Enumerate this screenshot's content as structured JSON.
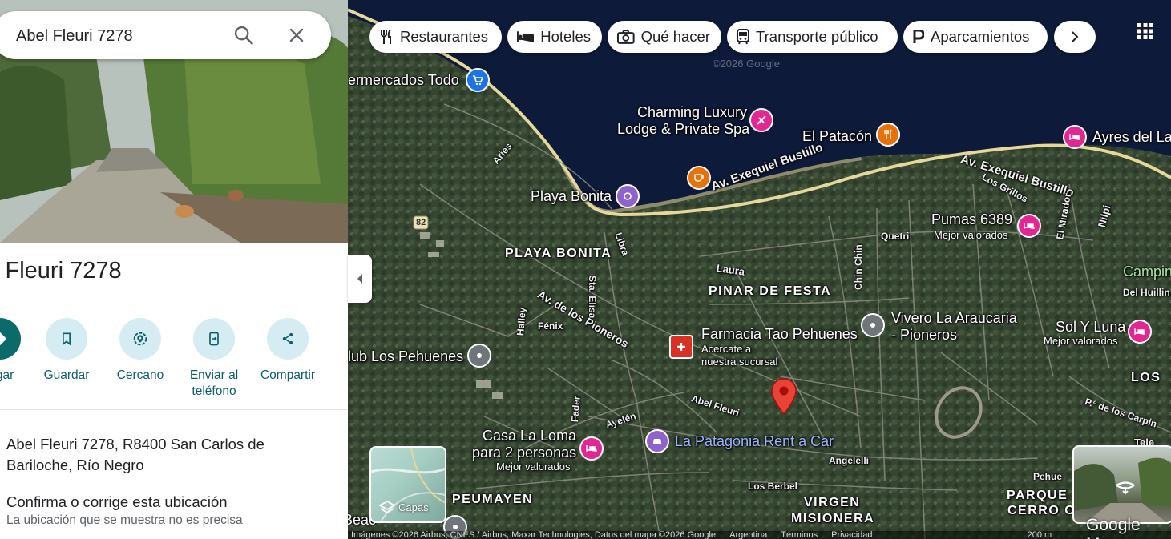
{
  "search": {
    "value": "Abel Fleuri 7278"
  },
  "place": {
    "title": "l Fleuri 7278",
    "actions": [
      {
        "label": "legar",
        "icon": "directions-icon"
      },
      {
        "label": "Guardar",
        "icon": "bookmark-icon"
      },
      {
        "label": "Cercano",
        "icon": "nearby-icon"
      },
      {
        "label": "Enviar al teléfono",
        "icon": "send-to-phone-icon"
      },
      {
        "label": "Compartir",
        "icon": "share-icon"
      }
    ],
    "address": "Abel Fleuri 7278, R8400 San Carlos de Bariloche, Río Negro",
    "confirm_title": "Confirma o corrige esta ubicación",
    "confirm_sub": "La ubicación que se muestra no es precisa"
  },
  "categories": [
    {
      "label": "Restaurantes",
      "icon": "restaurant-icon"
    },
    {
      "label": "Hoteles",
      "icon": "hotel-icon"
    },
    {
      "label": "Qué hacer",
      "icon": "camera-icon"
    },
    {
      "label": "Transporte público",
      "icon": "transit-icon"
    },
    {
      "label": "Aparcamientos",
      "icon": "parking-icon"
    }
  ],
  "map": {
    "pois": {
      "supermercado": "ermercados Todo",
      "charming_line1": "Charming Luxury",
      "charming_line2": "Lodge & Private Spa",
      "patacon": "El Patacón",
      "ayres": "Ayres del Lag",
      "playa_bonita": "Playa Bonita",
      "pumas": "Pumas 6389",
      "pumas_sub": "Mejor valorados",
      "camping": "Camping",
      "vivero_line1": "Vivero La Araucaria",
      "vivero_line2": "- Pioneros",
      "sol_y_luna": "Sol Y Luna",
      "sol_y_luna_sub": "Mejor valorados",
      "farmacia": "Farmacia Tao Pehuenes",
      "farmacia_sub1": "Acercate a",
      "farmacia_sub2": "nuestra sucursal",
      "club": "lub Los Pehuenes",
      "casa_line1": "Casa La Loma",
      "casa_line2": "para 2 personas",
      "casa_sub": "Mejor valorados",
      "patagonia_rent": "La Patagonia Rent a Car",
      "beac": "Beac"
    },
    "areas": {
      "playa_bonita": "PLAYA BONITA",
      "pinar_de_festa": "PINAR DE FESTA",
      "peumayen": "PEUMAYEN",
      "virgen": "VIRGEN",
      "misionera": "MISIONERA",
      "parque_de": "PARQUE DE",
      "cerro_ot": "CERRO OT",
      "los": "LOS"
    },
    "streets": {
      "bustillo_1": "Av. Exequiel Bustillo",
      "bustillo_2": "Av. Exequiel Bustillo",
      "los_grillos": "Los Grillos",
      "aries": "Aries",
      "libra": "Libra",
      "route_82": "82",
      "quetri": "Quetri",
      "el_mirador": "El Mirador",
      "nilpi": "Nilpi",
      "laura": "Laura",
      "chin_chin": "Chin Chin",
      "del_huillin": "Del Huillin",
      "sta_elisa": "Sta. Elisa",
      "halley": "Halley",
      "fenix": "Fénix",
      "pioneros": "Av. de los Pioneros",
      "abel_fleuri": "Abel Fleuri",
      "fader": "Fader",
      "ayelen": "Ayelén",
      "angelelli": "Angelelli",
      "los_berbel": "Los Berbel",
      "los_carpin": "P.º de los Carpin",
      "pehue": "Pehue",
      "tele": "Tele"
    },
    "layers_label": "Capas",
    "logo": "Google Maps",
    "attribution": "Imágenes ©2026 Airbus, CNES / Airbus, Maxar Technologies, Datos del mapa ©2026 Google",
    "footer_links": [
      "Argentina",
      "Términos",
      "Privacidad"
    ],
    "scale": "200 m",
    "watermark": "©2026 Google"
  },
  "colors": {
    "water": "#0d1a3a",
    "road": "#e6d79a",
    "pin_red": "#ea4335",
    "pin_pink": "#e52592",
    "pin_orange": "#e8710a",
    "pin_purple": "#8e63ce",
    "pin_blue": "#1a73e8",
    "accent_teal": "#0b6b6b"
  }
}
